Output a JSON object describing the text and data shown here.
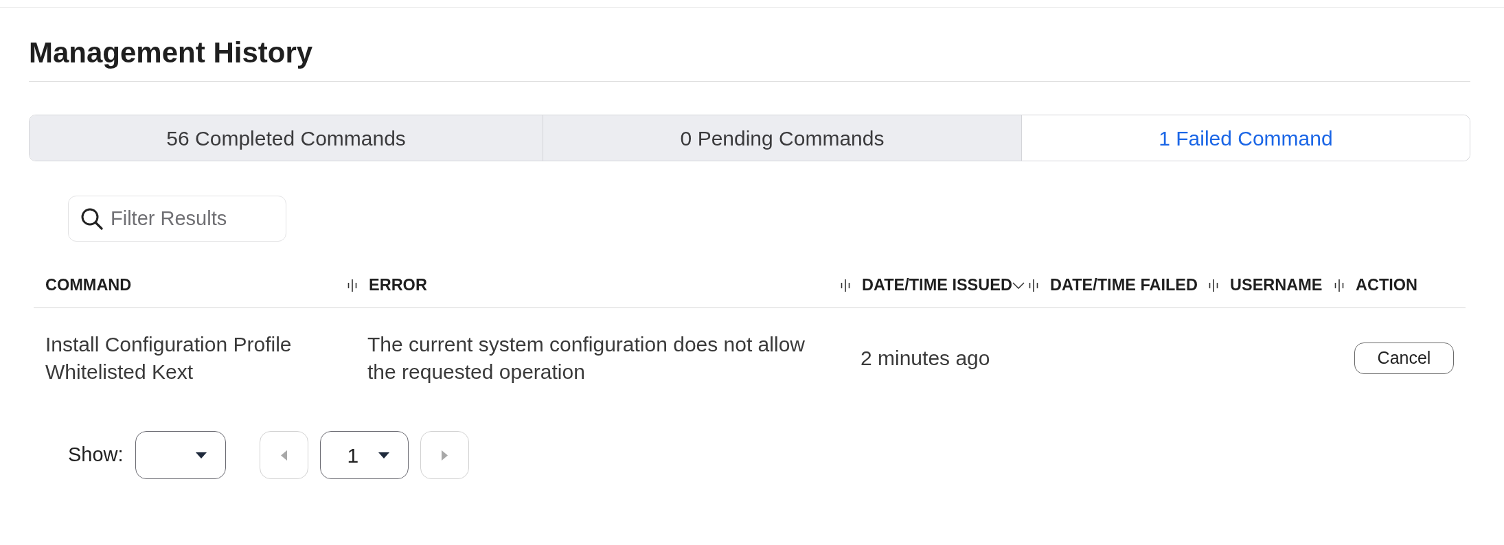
{
  "title": "Management History",
  "tabs": [
    {
      "label": "56 Completed Commands",
      "selected": false
    },
    {
      "label": "0 Pending Commands",
      "selected": false
    },
    {
      "label": "1 Failed Command",
      "selected": true
    }
  ],
  "filter": {
    "placeholder": "Filter Results"
  },
  "table": {
    "columns": [
      {
        "label": "COMMAND",
        "sorted": false
      },
      {
        "label": "ERROR",
        "sorted": false
      },
      {
        "label": "DATE/TIME ISSUED",
        "sorted": true
      },
      {
        "label": "DATE/TIME FAILED",
        "sorted": false
      },
      {
        "label": "USERNAME",
        "sorted": false
      },
      {
        "label": "ACTION",
        "sorted": false
      }
    ],
    "rows": [
      {
        "command": "Install Configuration Profile Whitelisted Kext",
        "error": "The current system configuration does not allow the requested operation",
        "date_time_issued": "2 minutes ago",
        "action": "Cancel"
      }
    ]
  },
  "pagination": {
    "label": "Show:",
    "page": "1",
    "previous_disabled": true,
    "next_disabled": true
  }
}
